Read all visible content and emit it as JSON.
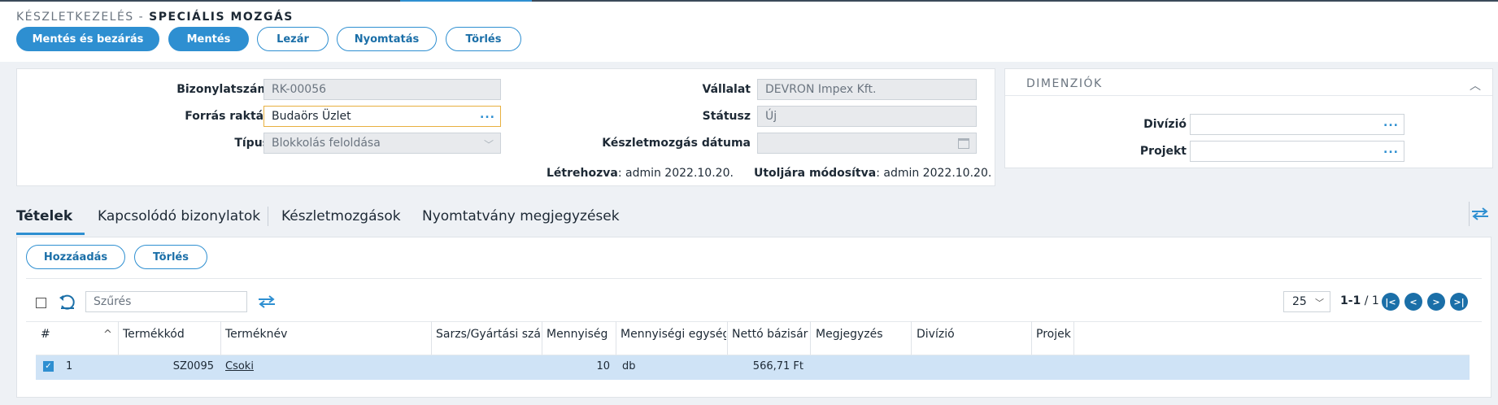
{
  "header": {
    "title_prefix": "KÉSZLETKEZELÉS -",
    "title_main": "SPECIÁLIS MOZGÁS"
  },
  "toolbar": {
    "save_close_label": "Mentés és bezárás",
    "save_label": "Mentés",
    "close_label": "Lezár",
    "print_label": "Nyomtatás",
    "delete_label": "Törlés"
  },
  "form": {
    "doc_number_label": "Bizonylatszám",
    "doc_number_value": "RK-00056",
    "source_warehouse_label": "Forrás raktár",
    "source_warehouse_value": "Budaörs Üzlet",
    "type_label": "Típus",
    "type_value": "Blokkolás feloldása",
    "company_label": "Vállalat",
    "company_value": "DEVRON Impex Kft.",
    "status_label": "Státusz",
    "status_value": "Új",
    "movement_date_label": "Készletmozgás dátuma",
    "movement_date_value": "",
    "created_label": "Létrehozva",
    "created_value": ": admin 2022.10.20.",
    "modified_label": "Utoljára módosítva",
    "modified_value": ": admin 2022.10.20."
  },
  "dimensions": {
    "title": "DIMENZIÓK",
    "division_label": "Divízió",
    "division_value": "",
    "project_label": "Projekt",
    "project_value": ""
  },
  "tabs": [
    {
      "label": "Tételek",
      "active": true
    },
    {
      "label": "Kapcsolódó bizonylatok",
      "active": false
    },
    {
      "label": "Készletmozgások",
      "active": false
    },
    {
      "label": "Nyomtatvány megjegyzések",
      "active": false
    }
  ],
  "grid": {
    "add_label": "Hozzáadás",
    "delete_label": "Törlés",
    "filter_placeholder": "Szűrés",
    "page_size": "25",
    "page_range": "1-1",
    "page_total": " / 1",
    "columns": [
      "#",
      "Termékkód",
      "Terméknév",
      "Sarzs/Gyártási szá",
      "Mennyiség",
      "Mennyiségi egység",
      "Nettó bázisár",
      "Megjegyzés",
      "Divízió",
      "Projek"
    ],
    "rows": [
      {
        "num": "1",
        "code": "SZ0095",
        "name": "Csoki",
        "batch": "",
        "qty": "10",
        "unit": "db",
        "price": "566,71 Ft",
        "note": "",
        "division": "",
        "project": ""
      }
    ]
  },
  "icons": {
    "refresh": "refresh-icon",
    "swap": "swap-arrows-icon",
    "accent_color": "#2e8fd1"
  }
}
